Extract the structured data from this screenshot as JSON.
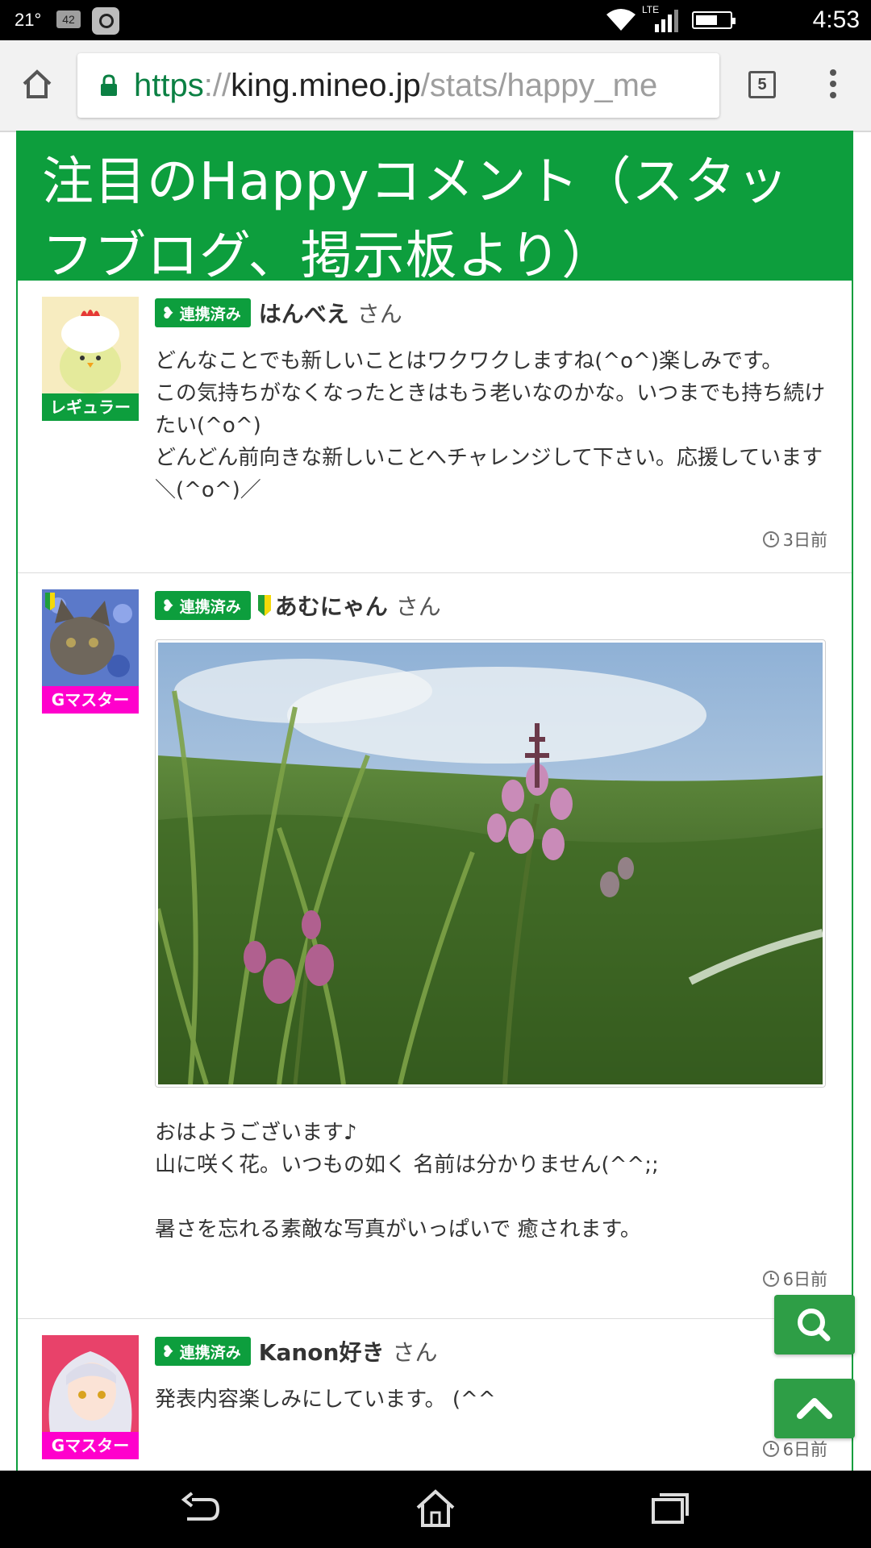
{
  "status_bar": {
    "temperature": "21°",
    "notification_count": "42",
    "network": "LTE",
    "time": "4:53"
  },
  "browser": {
    "url_scheme": "https",
    "url_separator": "://",
    "url_host": "king.mineo.jp",
    "url_path": "/stats/happy_me",
    "tab_count": "5"
  },
  "page": {
    "title": "注目のHappyコメント（スタッフブログ、掲示板より）"
  },
  "comments": [
    {
      "rank": "レギュラー",
      "linked_label": "連携済み",
      "username": "はんべえ",
      "honorific": "さん",
      "text": "どんなことでも新しいことはワクワクしますね(^o^)楽しみです。\nこの気持ちがなくなったときはもう老いなのかな。いつまでも持ち続けたい(^o^)\nどんどん前向きな新しいことへチャレンジして下さい。応援しています＼(^o^)／",
      "time": "3日前"
    },
    {
      "rank": "Gマスター",
      "linked_label": "連携済み",
      "username": "あむにゃん",
      "honorific": "さん",
      "text": "おはようございます♪\n山に咲く花。いつもの如く 名前は分かりません(^^;;\n\n暑さを忘れる素敵な写真がいっぱいで 癒されます。",
      "time": "6日前"
    },
    {
      "rank": "Gマスター",
      "linked_label": "連携済み",
      "username": "Kanon好き",
      "honorific": "さん",
      "text": "発表内容楽しみにしています。 (^^",
      "time": "6日前"
    }
  ],
  "colors": {
    "brand_green": "#0d9e3d",
    "master_pink": "#ff00cc",
    "fab_green": "#2e9e46"
  },
  "icons": [
    "home-icon",
    "lock-icon",
    "tabs-icon",
    "menu-icon",
    "clock-icon",
    "search-icon",
    "chevron-up-icon",
    "back-icon",
    "recents-icon",
    "beginner-mark-icon",
    "heart-leaf-icon"
  ]
}
